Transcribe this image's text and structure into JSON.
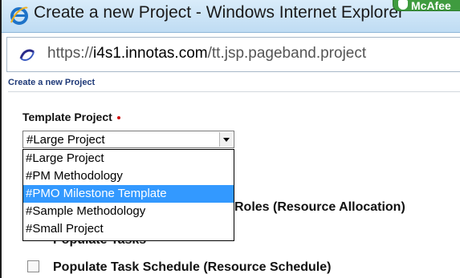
{
  "window": {
    "title": "Create a new Project - Windows Internet Explorer",
    "mcafee_label": "McAfee",
    "icon": "internet-explorer-icon"
  },
  "address_bar": {
    "icon": "page-loading-icon",
    "url_scheme": "https://",
    "url_host": "i4s1.innotas.com",
    "url_path": "/tt.jsp.pageband.project"
  },
  "page": {
    "title": "Create a new Project"
  },
  "form": {
    "template_label": "Template Project",
    "selected_value": "#Large Project",
    "options": [
      "#Large Project",
      "#PM Methodology",
      "#PMO Milestone Template",
      "#Sample Methodology",
      "#Small Project"
    ],
    "highlighted_option": "#PMO Milestone Template",
    "behind_labels": {
      "roles": "Roles (Resource Allocation)",
      "populate_tasks": "Populate Tasks",
      "task_schedule": "Populate Task Schedule (Resource Schedule)"
    }
  },
  "colors": {
    "selection": "#3399ff",
    "page_title": "#1f3a78",
    "required": "#d01010",
    "mcafee": "#3f9b3f"
  }
}
